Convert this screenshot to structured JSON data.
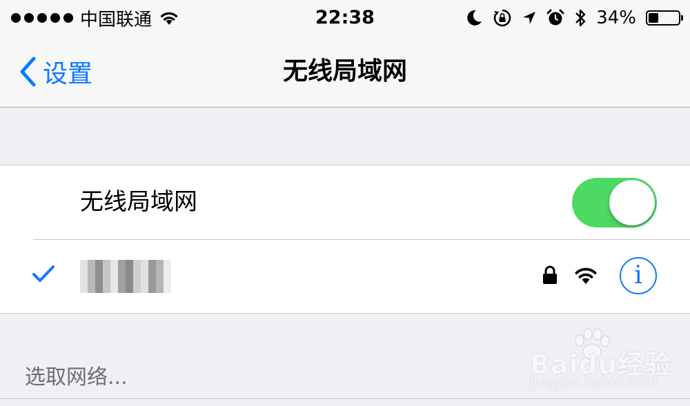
{
  "status_bar": {
    "carrier": "中国联通",
    "time": "22:38",
    "battery_percent": "34%",
    "battery_level": 0.34,
    "signal_bars": 5,
    "icons": [
      "wifi-icon",
      "moon-icon",
      "rotation-lock-icon",
      "location-icon",
      "alarm-icon",
      "bluetooth-icon",
      "battery-icon"
    ]
  },
  "nav": {
    "back_label": "设置",
    "title": "无线局域网"
  },
  "wifi_section": {
    "toggle_label": "无线局域网",
    "toggle_on": true,
    "connected_network": {
      "name_pixelated": true,
      "secured": true,
      "selected": true
    }
  },
  "networks_section": {
    "header": "选取网络..."
  },
  "watermark": {
    "brand": "Baidu经验",
    "url": "jingyan.baidu.com"
  },
  "colors": {
    "accent": "#0a7aff",
    "toggle_on": "#4cd964",
    "background": "#efeff4"
  }
}
